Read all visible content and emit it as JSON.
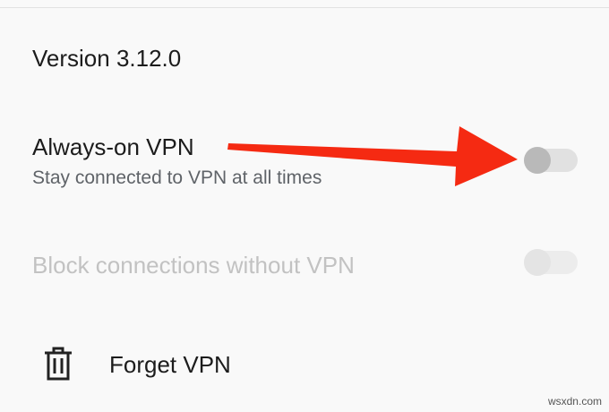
{
  "version_text": "Version 3.12.0",
  "always_on": {
    "title": "Always-on VPN",
    "subtitle": "Stay connected to VPN at all times",
    "enabled": false
  },
  "block_connections": {
    "title": "Block connections without VPN",
    "enabled": false,
    "disabled": true
  },
  "forget": {
    "label": "Forget VPN",
    "icon": "trash-icon"
  },
  "annotation": {
    "arrow_color": "#f52a12"
  },
  "watermark": "wsxdn.com"
}
